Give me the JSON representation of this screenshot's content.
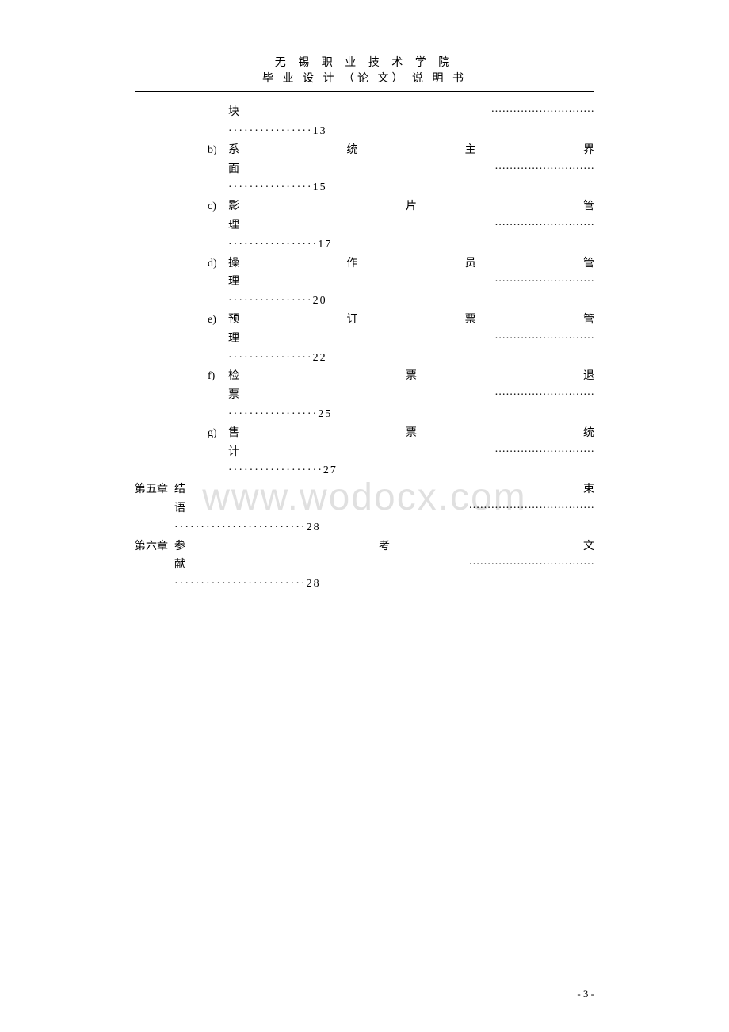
{
  "header": {
    "line1": "无 锡 职 业 技 术 学 院",
    "line2": "毕 业 设 计 （论 文） 说 明 书"
  },
  "toc": {
    "continuation": {
      "title": "块",
      "dots1": "····························",
      "dots2": "················",
      "page": "13"
    },
    "subs": [
      {
        "marker": "b)",
        "title": "系　　　　　统　　　　　主　　　　　界",
        "title_last": "面",
        "dots1": "···························",
        "dots2": "················",
        "page": "15"
      },
      {
        "marker": "c)",
        "title": "影　　　　　　　片　　　　　　　管",
        "title_last": "理",
        "dots1": "···························",
        "dots2": "·················",
        "page": "17"
      },
      {
        "marker": "d)",
        "title": "操　　　　　作　　　　　员　　　　　管",
        "title_last": "理",
        "dots1": "···························",
        "dots2": "················",
        "page": "20"
      },
      {
        "marker": "e)",
        "title": "预　　　　　订　　　　　票　　　　　管",
        "title_last": "理",
        "dots1": "···························",
        "dots2": "················",
        "page": "22"
      },
      {
        "marker": "f)",
        "title": "检　　　　　　　票　　　　　　　退",
        "title_last": "票",
        "dots1": "···························",
        "dots2": "·················",
        "page": "25"
      },
      {
        "marker": "g)",
        "title": "售　　　　　　　票　　　　　　　统",
        "title_last": "计",
        "dots1": "···························",
        "dots2": "··················",
        "page": "27"
      }
    ],
    "chapters": [
      {
        "chapter": "第五章",
        "title": "结　　　　　　　　　　　　　　　　　　　　束",
        "title_last": "语",
        "dots1": "··································",
        "dots2": "·························",
        "page": "28"
      },
      {
        "chapter": "第六章",
        "title": "参　　　　　　　　考　　　　　　　　文",
        "title_last": "献",
        "dots1": "··································",
        "dots2": "·························",
        "page": "28"
      }
    ]
  },
  "watermark": "www.wodocx.com",
  "page_number": "- 3 -"
}
